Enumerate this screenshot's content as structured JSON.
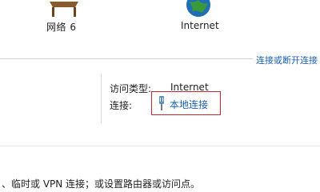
{
  "networks": [
    {
      "label": "网络  6",
      "icon": "network-bench-icon"
    },
    {
      "label": "Internet",
      "icon": "globe-icon"
    }
  ],
  "header_link": "连接或断开连接",
  "details": {
    "access_type_label": "访问类型:",
    "access_type_value": "Internet",
    "connection_label": "连接:",
    "connection_value": "本地连接",
    "connection_icon": "ethernet-plug-icon"
  },
  "bottom_text": "、临时或 VPN 连接；或设置路由器或访问点。",
  "colors": {
    "link": "#1a5fb4",
    "highlight_box": "#c8282d"
  }
}
